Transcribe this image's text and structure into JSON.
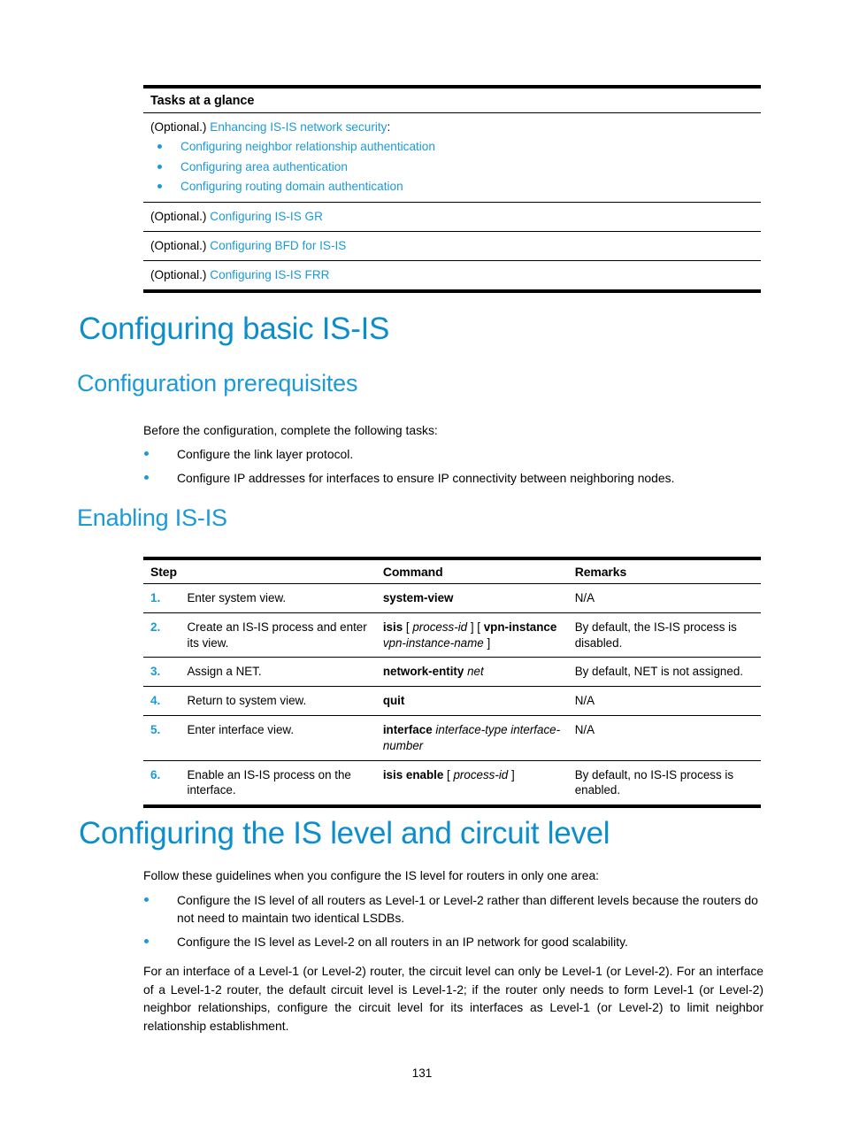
{
  "tasks_table": {
    "header": "Tasks at a glance",
    "rows": [
      {
        "optional_label": "(Optional.)",
        "link": "Enhancing IS-IS network security",
        "suffix": ":",
        "sublist": [
          "Configuring neighbor relationship authentication",
          "Configuring area authentication",
          "Configuring routing domain authentication"
        ]
      },
      {
        "optional_label": "(Optional.)",
        "link": "Configuring IS-IS GR",
        "suffix": ""
      },
      {
        "optional_label": "(Optional.)",
        "link": "Configuring BFD for IS-IS",
        "suffix": ""
      },
      {
        "optional_label": "(Optional.)",
        "link": "Configuring IS-IS FRR",
        "suffix": ""
      }
    ]
  },
  "headings": {
    "configuring_basic_isis": "Configuring basic IS-IS",
    "configuration_prerequisites": "Configuration prerequisites",
    "enabling_isis": "Enabling IS-IS",
    "configuring_is_level": "Configuring the IS level and circuit level"
  },
  "prerequisites": {
    "intro": "Before the configuration, complete the following tasks:",
    "items": [
      "Configure the link layer protocol.",
      "Configure IP addresses for interfaces to ensure IP connectivity between neighboring nodes."
    ]
  },
  "steps_table": {
    "columns": {
      "step": "Step",
      "command": "Command",
      "remarks": "Remarks"
    },
    "rows": [
      {
        "number": "1.",
        "step": "Enter system view.",
        "command_parts": [
          {
            "text": "system-view",
            "style": "bold"
          }
        ],
        "remarks": "N/A"
      },
      {
        "number": "2.",
        "step": "Create an IS-IS process and enter its view.",
        "command_parts": [
          {
            "text": "isis",
            "style": "bold"
          },
          {
            "text": " [ ",
            "style": "plain"
          },
          {
            "text": "process-id",
            "style": "italic"
          },
          {
            "text": " ] [ ",
            "style": "plain"
          },
          {
            "text": "vpn-instance",
            "style": "bold"
          },
          {
            "text": " ",
            "style": "plain"
          },
          {
            "text": "vpn-instance-name",
            "style": "italic"
          },
          {
            "text": " ]",
            "style": "plain"
          }
        ],
        "remarks": "By default, the IS-IS process is disabled."
      },
      {
        "number": "3.",
        "step": "Assign a NET.",
        "command_parts": [
          {
            "text": "network-entity",
            "style": "bold"
          },
          {
            "text": " ",
            "style": "plain"
          },
          {
            "text": "net",
            "style": "italic"
          }
        ],
        "remarks": "By default, NET is not assigned."
      },
      {
        "number": "4.",
        "step": "Return to system view.",
        "command_parts": [
          {
            "text": "quit",
            "style": "bold"
          }
        ],
        "remarks": "N/A"
      },
      {
        "number": "5.",
        "step": "Enter interface view.",
        "command_parts": [
          {
            "text": "interface",
            "style": "bold"
          },
          {
            "text": " ",
            "style": "plain"
          },
          {
            "text": "interface-type interface-number",
            "style": "italic"
          }
        ],
        "remarks": "N/A"
      },
      {
        "number": "6.",
        "step": "Enable an IS-IS process on the interface.",
        "command_parts": [
          {
            "text": "isis enable",
            "style": "bold"
          },
          {
            "text": " [ ",
            "style": "plain"
          },
          {
            "text": "process-id",
            "style": "italic"
          },
          {
            "text": " ]",
            "style": "plain"
          }
        ],
        "remarks": "By default, no IS-IS process is enabled."
      }
    ]
  },
  "is_level": {
    "intro": "Follow these guidelines when you configure the IS level for routers in only one area:",
    "items": [
      "Configure the IS level of all routers as Level-1 or Level-2 rather than different levels because the routers do not need to maintain two identical LSDBs.",
      "Configure the IS level as Level-2 on all routers in an IP network for good scalability."
    ],
    "paragraph": "For an interface of a Level-1 (or Level-2) router, the circuit level can only be Level-1 (or Level-2). For an interface of a Level-1-2 router, the default circuit level is Level-1-2; if the router only needs to form Level-1 (or Level-2) neighbor relationships, configure the circuit level for its interfaces as Level-1 (or Level-2) to limit neighbor relationship establishment."
  },
  "footer": {
    "page_number": "131"
  },
  "colors": {
    "link": "#1b9ad7",
    "heading": "#0c8ecd",
    "text": "#000000"
  }
}
